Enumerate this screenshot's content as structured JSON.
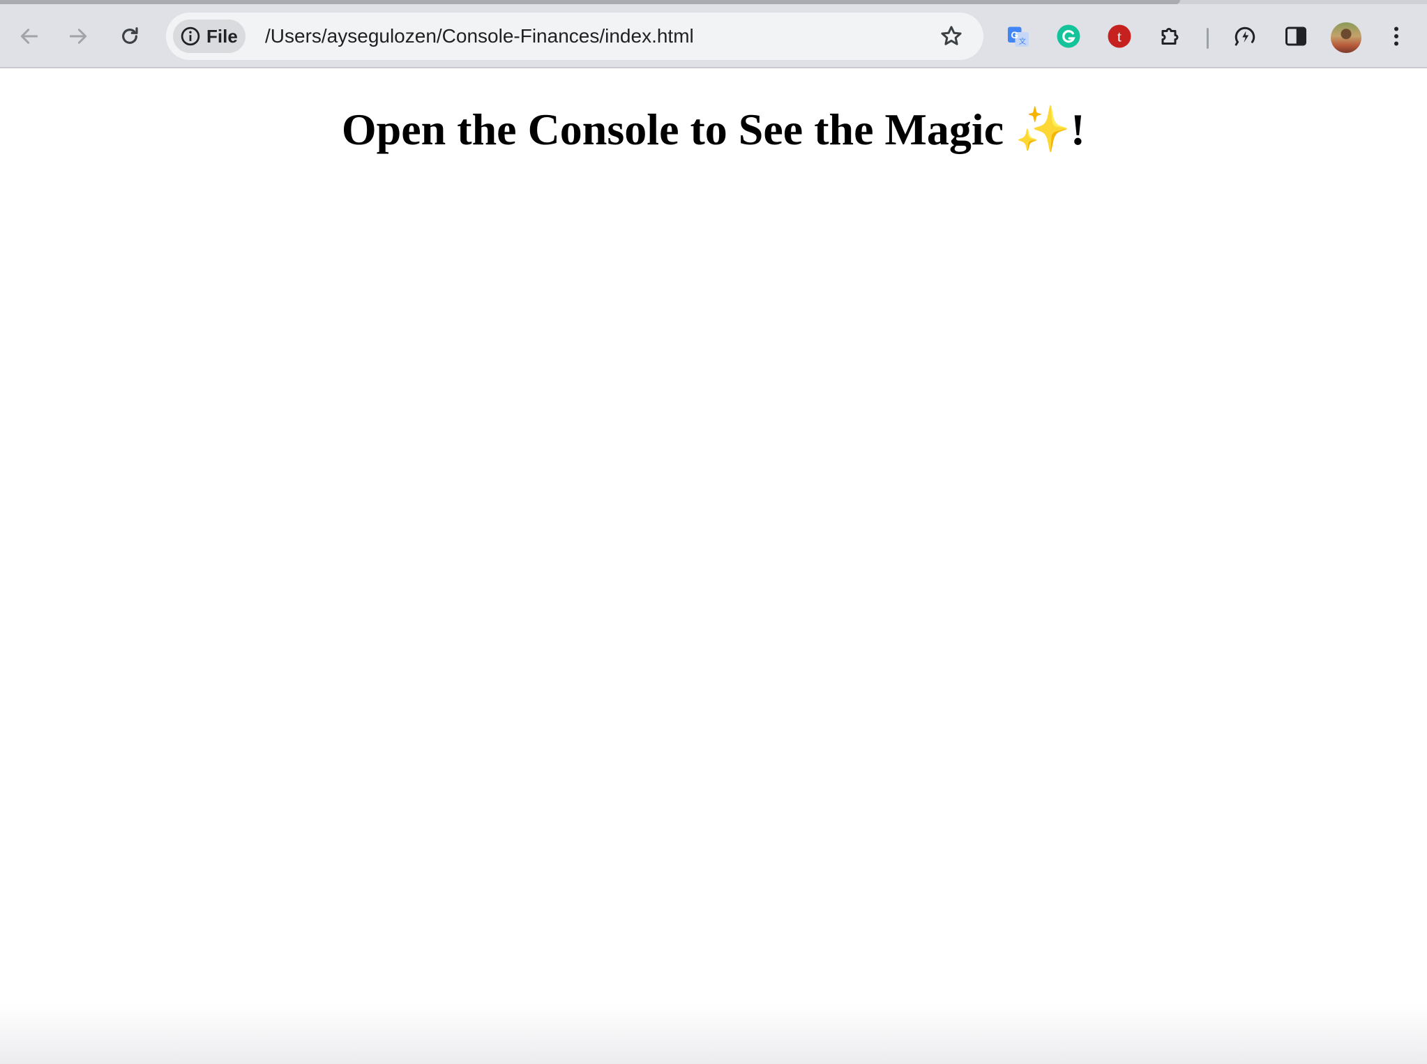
{
  "browser": {
    "chip_label": "File",
    "url": "/Users/aysegulozen/Console-Finances/index.html",
    "icons": [
      "back-arrow-icon",
      "forward-arrow-icon",
      "reload-icon",
      "info-icon",
      "star-icon",
      "google-translate-icon",
      "grammarly-icon",
      "t-extension-icon",
      "puzzle-extensions-icon",
      "performance-icon",
      "side-panel-icon",
      "menu-dots-icon"
    ]
  },
  "page": {
    "heading": "Open the Console to See the Magic ✨!"
  },
  "colors": {
    "toolbar": "#dfe1e6",
    "omnibox": "#f1f3f4",
    "grammarly": "#15c39a",
    "t_extension": "#c5221f",
    "translate_blue": "#4285f4"
  }
}
